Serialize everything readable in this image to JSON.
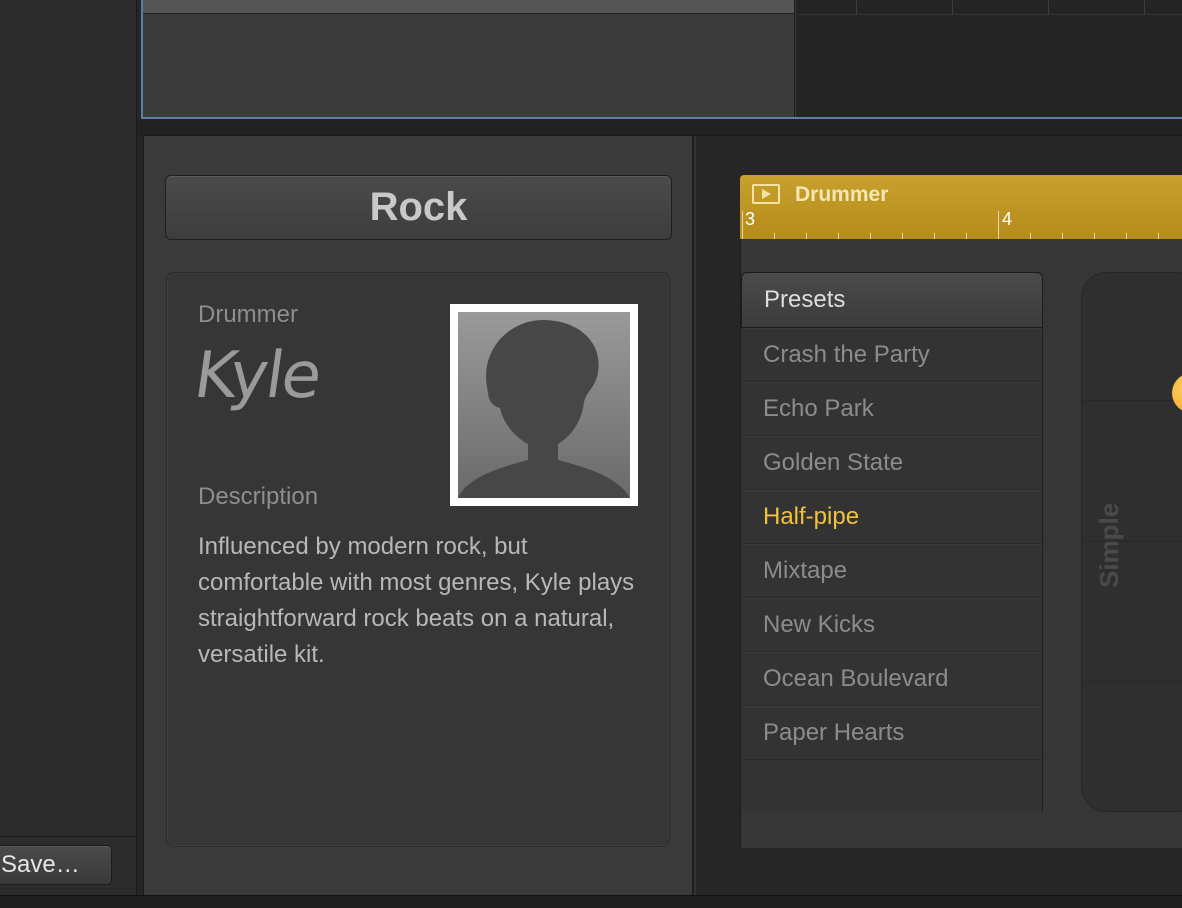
{
  "sidebar": {
    "save_button": "Save…"
  },
  "editor": {
    "genre": "Rock",
    "drummer": {
      "label": "Drummer",
      "name": "Kyle",
      "description_label": "Description",
      "description": "Influenced by modern rock, but comfortable with most genres, Kyle plays straightforward rock beats on a natural, versatile kit."
    },
    "region": {
      "title": "Drummer",
      "bar_start": "3",
      "bar_next": "4"
    },
    "presets": {
      "header": "Presets",
      "items": [
        {
          "label": "Crash the Party"
        },
        {
          "label": "Echo Park"
        },
        {
          "label": "Golden State"
        },
        {
          "label": "Half-pipe"
        },
        {
          "label": "Mixtape"
        },
        {
          "label": "New Kicks"
        },
        {
          "label": "Ocean Boulevard"
        },
        {
          "label": "Paper Hearts"
        }
      ],
      "selected": "Half-pipe"
    },
    "xy_pad": {
      "axis_label": "Simple"
    }
  },
  "colors": {
    "accent": "#f0c33b",
    "region": "#c8a02c",
    "selection_border": "#5b7ea8"
  }
}
